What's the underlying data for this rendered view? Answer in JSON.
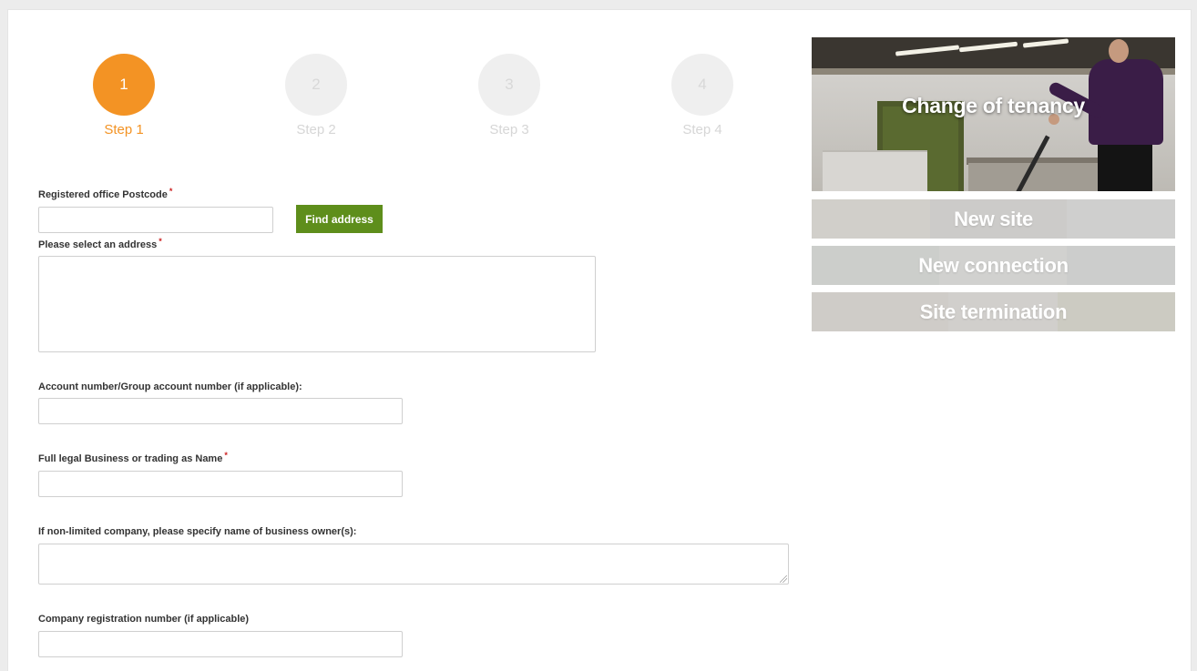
{
  "steps": [
    {
      "number": "1",
      "label": "Step 1",
      "active": true
    },
    {
      "number": "2",
      "label": "Step 2",
      "active": false
    },
    {
      "number": "3",
      "label": "Step 3",
      "active": false
    },
    {
      "number": "4",
      "label": "Step 4",
      "active": false
    }
  ],
  "form": {
    "postcode_label": "Registered office Postcode",
    "postcode_value": "",
    "find_address_button": "Find address",
    "address_label": "Please select an address",
    "address_value": "",
    "account_label": "Account number/Group account number (if applicable):",
    "account_value": "",
    "business_name_label": "Full legal Business or trading as Name",
    "business_name_value": "",
    "owner_label": "If non-limited company, please specify name of business owner(s):",
    "owner_value": "",
    "company_reg_label": "Company registration number (if applicable)",
    "company_reg_value": "",
    "required_marker": "*"
  },
  "side_panel": {
    "hero_label": "Change of tenancy",
    "tabs": [
      "New site",
      "New connection",
      "Site termination"
    ]
  },
  "colors": {
    "accent": "#f39324",
    "button": "#5e8e1b",
    "required": "#cc1f1f"
  }
}
